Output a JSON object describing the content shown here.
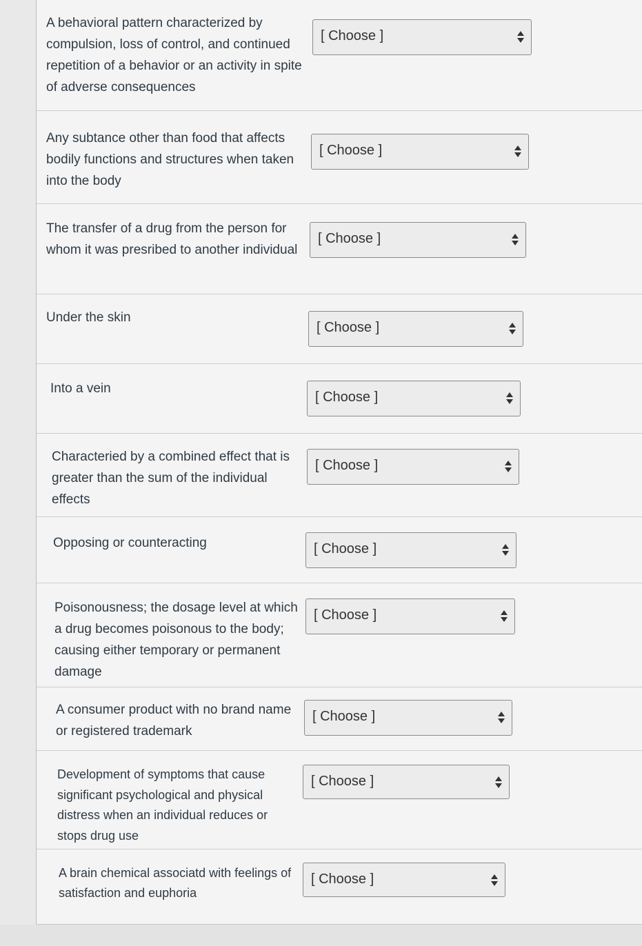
{
  "questions": [
    {
      "prompt": "A behavioral pattern characterized by compulsion, loss of control, and continued repetition of a behavior or an activity in spite of adverse consequences",
      "selected": "[ Choose ]"
    },
    {
      "prompt": "Any subtance other than food that affects bodily functions and structures when taken into the body",
      "selected": "[ Choose ]"
    },
    {
      "prompt": "The transfer of a drug from the person for whom it was presribed to another individual",
      "selected": "[ Choose ]"
    },
    {
      "prompt": "Under the skin",
      "selected": "[ Choose ]"
    },
    {
      "prompt": "Into a vein",
      "selected": "[ Choose ]"
    },
    {
      "prompt": "Characteried by a combined effect that is greater than the sum of the individual effects",
      "selected": "[ Choose ]"
    },
    {
      "prompt": "Opposing or counteracting",
      "selected": "[ Choose ]"
    },
    {
      "prompt": "Poisonousness; the dosage level at which a drug becomes poisonous to the body; causing either temporary or permanent damage",
      "selected": "[ Choose ]"
    },
    {
      "prompt": "A consumer product with no brand name or registered trademark",
      "selected": "[ Choose ]"
    },
    {
      "prompt": "Development of symptoms that cause significant psychological and physical distress when an individual reduces or stops drug use",
      "selected": "[ Choose ]"
    },
    {
      "prompt": "A brain chemical associatd with feelings of satisfaction and euphoria",
      "selected": "[ Choose ]"
    }
  ]
}
